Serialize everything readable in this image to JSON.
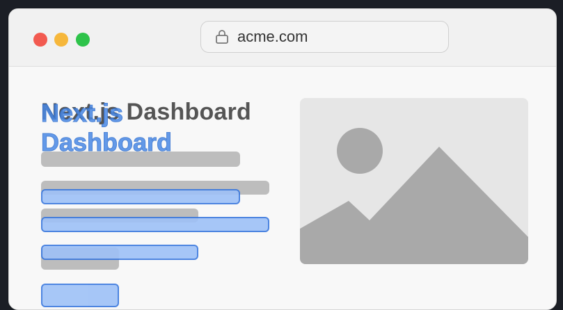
{
  "browser": {
    "url": "acme.com",
    "traffic_lights": [
      "red",
      "yellow",
      "green"
    ],
    "colors": {
      "red": "#f25a50",
      "yellow": "#f6b73b",
      "green": "#2ec34a"
    }
  },
  "page": {
    "heading_gray": "Next.js Dashboard",
    "heading_blue_line1": "Next.js",
    "heading_blue_line2": "Dashboard",
    "accent_color": "#3a78de",
    "image_placeholder_icon": "image-placeholder-icon"
  }
}
